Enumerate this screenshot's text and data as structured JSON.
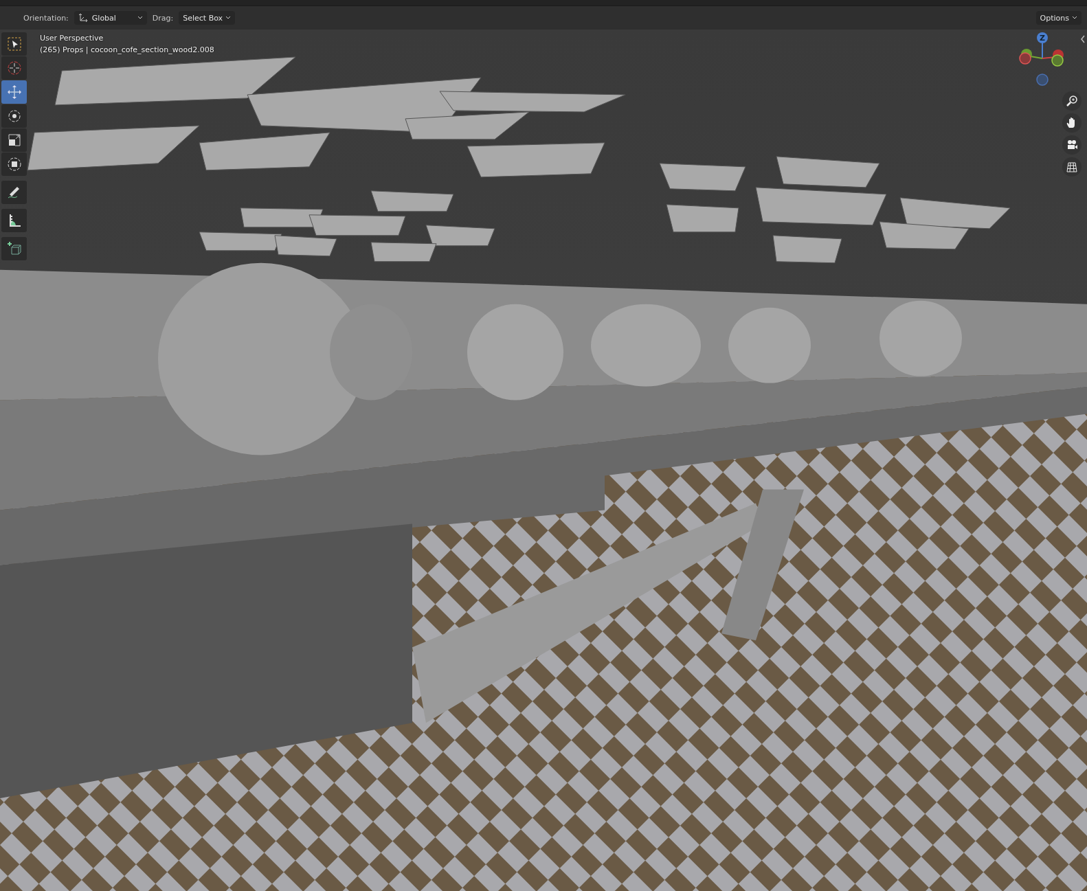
{
  "tool_header": {
    "orientation_label": "Orientation:",
    "orientation_value": "Global",
    "drag_label": "Drag:",
    "drag_value": "Select Box",
    "options_label": "Options"
  },
  "viewport": {
    "view_name": "User Perspective",
    "object_info": "(265) Props | cocoon_cofe_section_wood2.008"
  },
  "toolbar": [
    {
      "kind": "select_box",
      "selected": false
    },
    {
      "kind": "cursor",
      "selected": false
    },
    {
      "kind": "move",
      "selected": true
    },
    {
      "kind": "rotate",
      "selected": false
    },
    {
      "kind": "scale",
      "selected": false
    },
    {
      "kind": "transform",
      "selected": false
    },
    {
      "kind": "annotate",
      "selected": false
    },
    {
      "kind": "measure",
      "selected": false
    },
    {
      "kind": "add_cube",
      "selected": false
    }
  ],
  "gizmo": {
    "z_label": "Z"
  },
  "nav_buttons": [
    {
      "kind": "zoom"
    },
    {
      "kind": "pan"
    },
    {
      "kind": "camera"
    },
    {
      "kind": "ortho"
    }
  ]
}
